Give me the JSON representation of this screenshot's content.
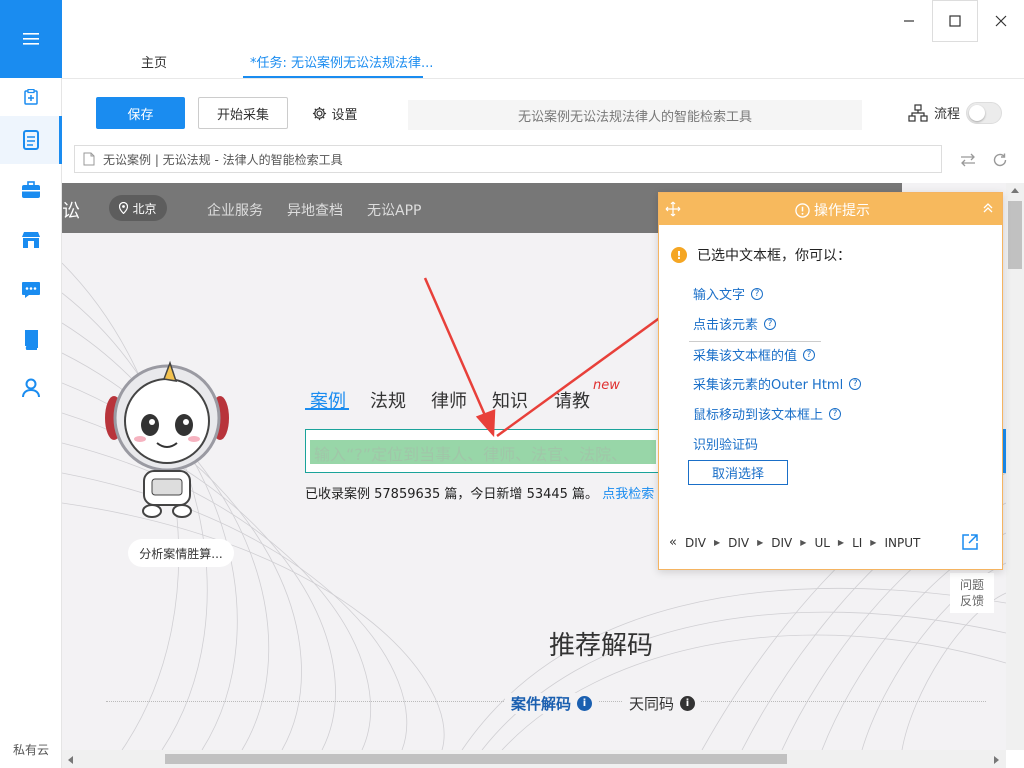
{
  "window": {
    "minimize": "–",
    "maximize": "□",
    "close": "✕"
  },
  "tabs": [
    {
      "label": "主页"
    },
    {
      "label": "*任务: 无讼案例无讼法规法律..."
    }
  ],
  "toolbar": {
    "save": "保存",
    "start": "开始采集",
    "settings": "设置",
    "title": "无讼案例无讼法规法律人的智能检索工具",
    "flow": "流程"
  },
  "address": {
    "page_title": "无讼案例 | 无讼法规 - 法律人的智能检索工具"
  },
  "rail": {
    "footer": "私有云"
  },
  "site": {
    "logo_fragment": "讼",
    "city": "北京",
    "links": [
      "企业服务",
      "异地查档",
      "无讼APP"
    ],
    "mascot_label": "分析案情胜算...",
    "search_tabs": [
      "案例",
      "法规",
      "律师",
      "知识",
      "请教"
    ],
    "new_badge": "new",
    "search_placeholder": "输入“?”定位到当事人、律师、法官、法院、",
    "stats_text": "已收录案例 57859635 篇，今日新增 53445 篇。",
    "stats_link": "点我检索",
    "feedback": [
      "问题",
      "反馈"
    ],
    "section_title": "推荐解码",
    "section_tabs": [
      "案件解码",
      "天同码"
    ]
  },
  "panel": {
    "title": "操作提示",
    "message": "已选中文本框，你可以：",
    "actions": [
      {
        "label": "输入文字",
        "help": true
      },
      {
        "label": "点击该元素",
        "help": true
      },
      {
        "label": "采集该文本框的值",
        "help": true
      },
      {
        "label": "采集该元素的Outer Html",
        "help": true
      },
      {
        "label": "鼠标移动到该文本框上",
        "help": true
      },
      {
        "label": "识别验证码",
        "help": false
      }
    ],
    "cancel": "取消选择",
    "breadcrumb": [
      "DIV",
      "DIV",
      "DIV",
      "UL",
      "LI",
      "INPUT"
    ]
  },
  "colors": {
    "accent": "#1a8cf0",
    "panel_header": "#f7b95d",
    "arrow": "#e8403a"
  }
}
